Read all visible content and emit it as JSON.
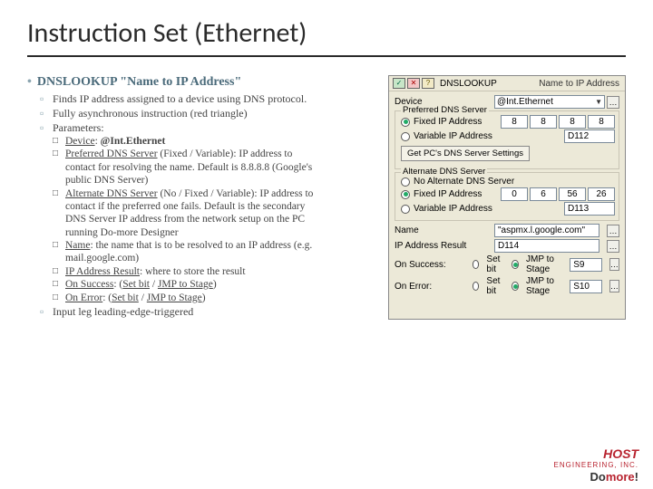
{
  "title": "Instruction Set (Ethernet)",
  "main_bullet": "DNSLOOKUP \"Name to IP Address\"",
  "sub": {
    "a": "Finds IP address assigned to a device using DNS protocol.",
    "b": "Fully asynchronous instruction (red triangle)",
    "c": "Parameters:",
    "d": "Input leg leading-edge-triggered"
  },
  "params": {
    "device": {
      "label": "Device",
      "value": "@Int.Ethernet"
    },
    "pref": {
      "label": "Preferred DNS Server",
      "desc": " (Fixed / Variable): IP address to contact for resolving the name. Default is 8.8.8.8 (Google's public DNS Server)"
    },
    "alt": {
      "label": "Alternate DNS Server",
      "desc": " (No / Fixed / Variable): IP address to contact if the preferred one fails. Default is the secondary DNS Server IP address from the network setup on the PC running Do-more Designer"
    },
    "name": {
      "label": "Name",
      "desc": ": the name that is to be resolved to an IP address (e.g. mail.google.com)"
    },
    "ipr": {
      "label": "IP Address Result",
      "desc": ": where to store the result"
    },
    "succ": {
      "label": "On Success",
      "desc": ": (",
      "o1": "Set bit",
      "sep": " / ",
      "o2": "JMP to Stage",
      "close": ")"
    },
    "err": {
      "label": "On Error",
      "desc": ": (",
      "o1": "Set bit",
      "sep": " / ",
      "o2": "JMP to Stage",
      "close": ")"
    }
  },
  "dialog": {
    "title": "DNSLOOKUP",
    "subtitle": "Name to IP Address",
    "device_label": "Device",
    "device_value": "@Int.Ethernet",
    "pref_group": "Preferred DNS Server",
    "radio_fixed": "Fixed IP Address",
    "radio_var": "Variable IP Address",
    "ip": {
      "a": "8",
      "b": "8",
      "c": "8",
      "d": "8"
    },
    "var_field": "D112",
    "dns_button": "Get PC's DNS Server Settings",
    "alt_group": "Alternate DNS Server",
    "radio_none": "No Alternate DNS Server",
    "alt_ip": {
      "a": "0",
      "b": "6",
      "c": "56",
      "d": "26"
    },
    "alt_var": "D113",
    "name_label": "Name",
    "name_value": "\"aspmx.l.google.com\"",
    "ipr_label": "IP Address Result",
    "ipr_value": "D114",
    "succ_label": "On Success:",
    "err_label": "On Error:",
    "opt_set": "Set bit",
    "opt_jmp": "JMP to Stage",
    "succ_stage": "S9",
    "err_stage": "S10"
  },
  "footer": {
    "host": "HOST",
    "eng": "ENGINEERING, INC.",
    "domore_a": "Do",
    "domore_b": "more",
    "domore_c": "!"
  }
}
